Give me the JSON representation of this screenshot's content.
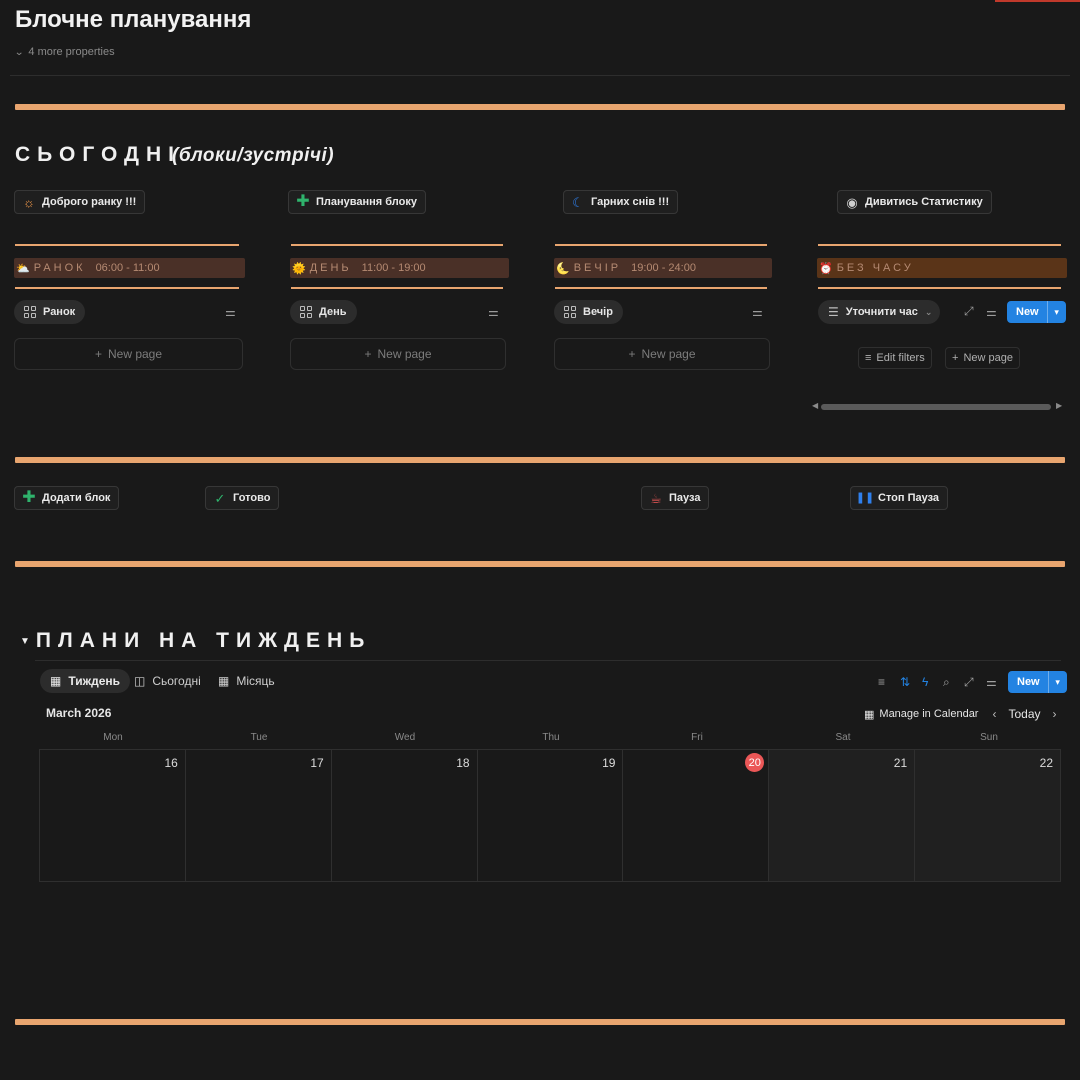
{
  "page": {
    "title": "Блочне планування",
    "more_properties": "4 more properties"
  },
  "today_section": {
    "title": "СЬОГОДНІ",
    "subtitle": "(блоки/зустрічі)",
    "action_buttons": [
      {
        "label": "Доброго ранку !!!",
        "icon": "sun-icon"
      },
      {
        "label": "Планування блоку",
        "icon": "plus-icon"
      },
      {
        "label": "Гарних снів !!!",
        "icon": "moon-icon"
      },
      {
        "label": "Дивитись Статистику",
        "icon": "eye-icon"
      }
    ],
    "columns": [
      {
        "name": "РАНОК",
        "time": "06:00 - 11:00",
        "emoji": "⛅",
        "view": "Ранок",
        "new_page": "New page"
      },
      {
        "name": "ДЕНЬ",
        "time": "11:00 - 19:00",
        "emoji": "🌞",
        "view": "День",
        "new_page": "New page"
      },
      {
        "name": "ВЕЧІР",
        "time": "19:00 - 24:00",
        "emoji": "🌜",
        "view": "Вечір",
        "new_page": "New page"
      },
      {
        "name": "БЕЗ ЧАСУ",
        "time": "",
        "emoji": "⏰",
        "view": "Уточнити час",
        "new_button": "New",
        "edit_filters": "Edit filters",
        "new_page": "New page"
      }
    ]
  },
  "controls": [
    {
      "label": "Додати блок",
      "icon": "plus-icon"
    },
    {
      "label": "Готово",
      "icon": "check-icon"
    },
    {
      "label": "Пауза",
      "icon": "coffee-icon"
    },
    {
      "label": "Стоп Пауза",
      "icon": "pause-icon"
    }
  ],
  "week_section": {
    "title": "ПЛАНИ НА ТИЖДЕНЬ",
    "tabs": [
      "Тиждень",
      "Сьогодні",
      "Місяць"
    ],
    "new_button": "New",
    "calendar": {
      "month": "March 2026",
      "manage": "Manage in Calendar",
      "today": "Today",
      "weekdays": [
        "Mon",
        "Tue",
        "Wed",
        "Thu",
        "Fri",
        "Sat",
        "Sun"
      ],
      "days": [
        "16",
        "17",
        "18",
        "19",
        "20",
        "21",
        "22"
      ],
      "today_index": 4
    }
  },
  "colors": {
    "accent_bar": "#e8a56f",
    "band": "#4a3027",
    "today_badge": "#eb5757",
    "primary_button": "#2383e2"
  }
}
